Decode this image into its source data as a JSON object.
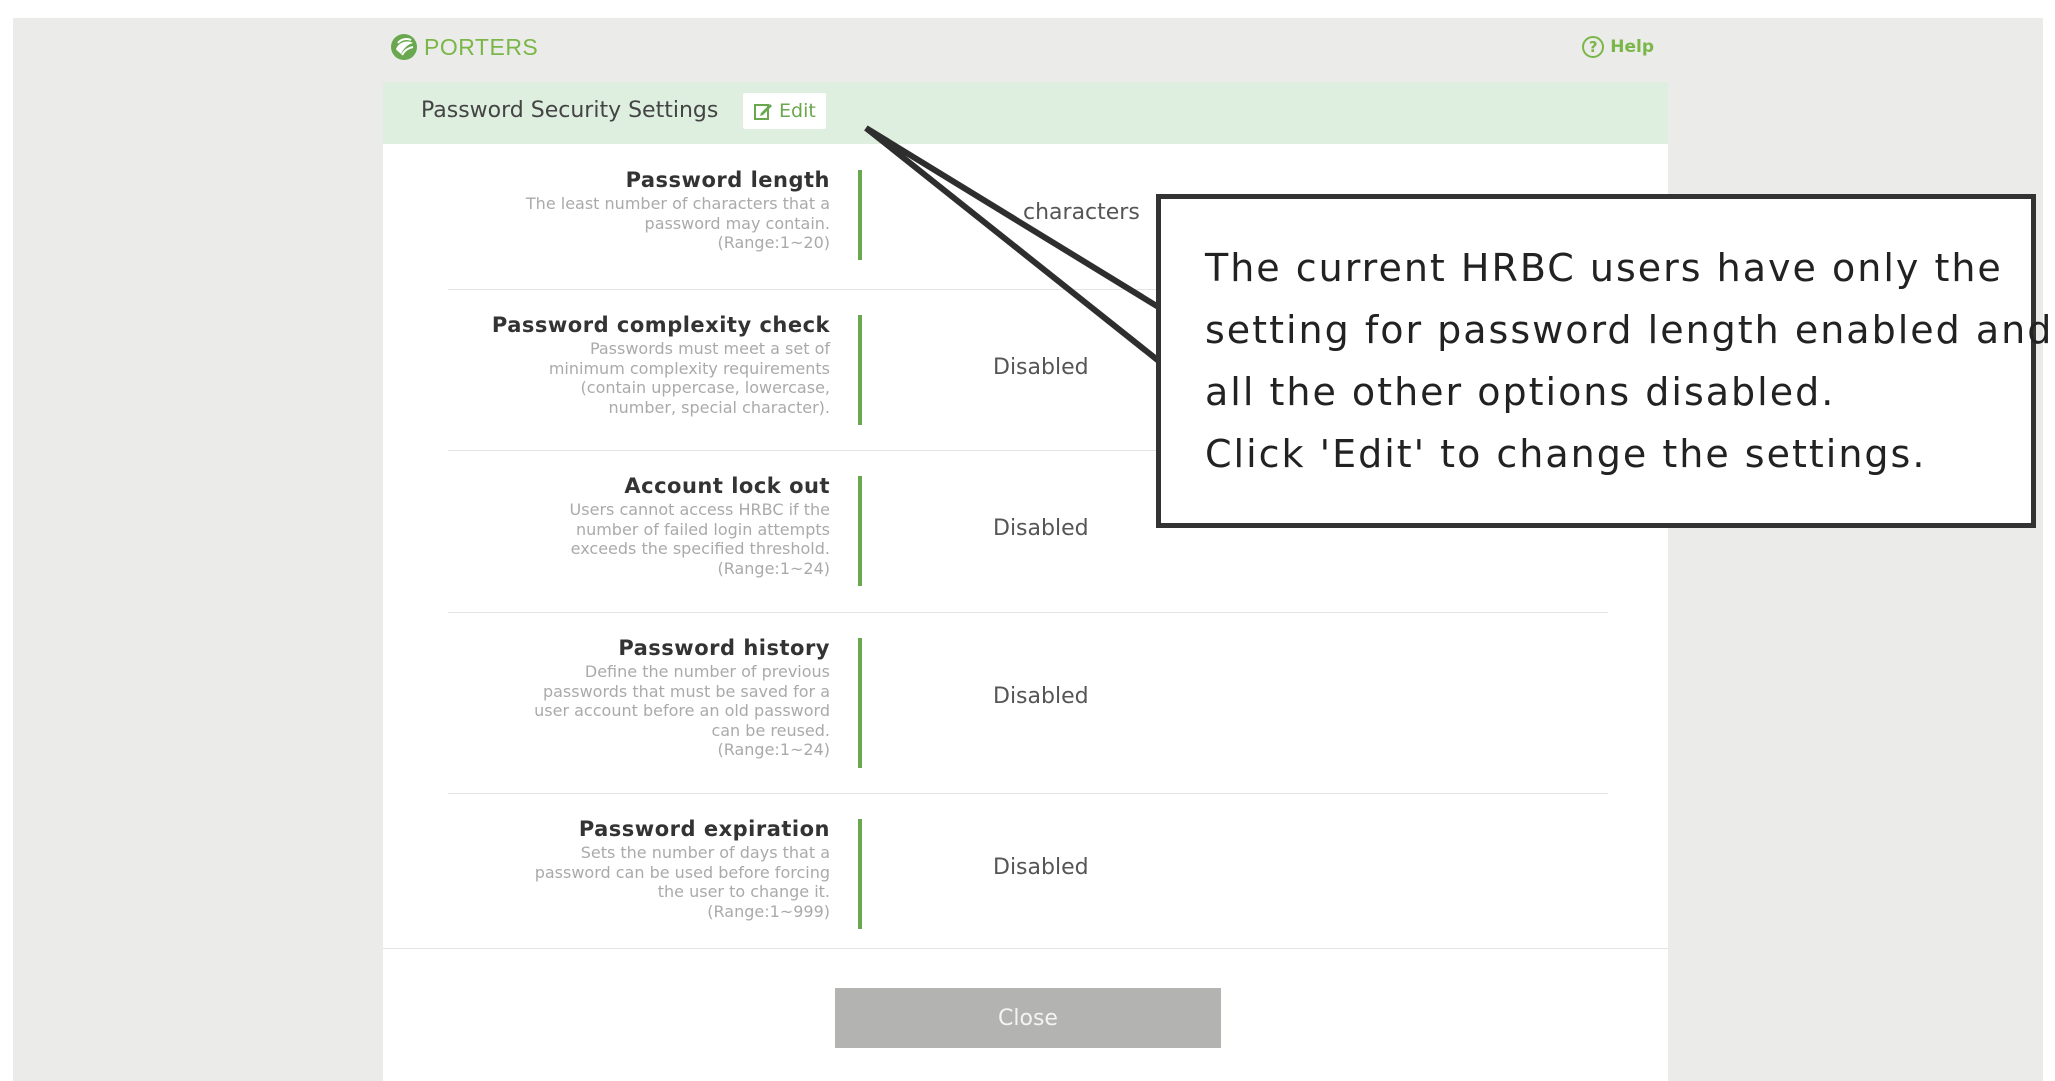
{
  "brand": {
    "name": "PORTERS"
  },
  "help": {
    "label": "Help"
  },
  "dialog": {
    "title": "Password Security Settings",
    "edit_label": "Edit",
    "close_label": "Close"
  },
  "settings": [
    {
      "label": "Password length",
      "desc": [
        "The least number of characters that a",
        "password may contain.",
        "(Range:1~20)"
      ],
      "value": "characters"
    },
    {
      "label": "Password complexity check",
      "desc": [
        "Passwords must meet a set of",
        "minimum complexity requirements",
        "(contain uppercase, lowercase,",
        "number, special character)."
      ],
      "value": "Disabled"
    },
    {
      "label": "Account lock out",
      "desc": [
        "Users cannot access HRBC if the",
        "number of failed login attempts",
        "exceeds the specified threshold.",
        "(Range:1~24)"
      ],
      "value": "Disabled"
    },
    {
      "label": "Password history",
      "desc": [
        "Define the number of previous",
        "passwords that must be saved for a",
        "user account before an old password",
        "can be reused.",
        "(Range:1~24)"
      ],
      "value": "Disabled"
    },
    {
      "label": "Password expiration",
      "desc": [
        "Sets the number of days that a",
        "password can be used before forcing",
        "the user to change it.",
        "(Range:1~999)"
      ],
      "value": "Disabled"
    }
  ],
  "callout": {
    "lines": [
      "The current HRBC users have only the",
      "setting for password length enabled and",
      "all the other options disabled.",
      "Click 'Edit' to change the settings."
    ]
  },
  "colors": {
    "accent": "#6aa84f",
    "header_bg": "#deefe0",
    "page_bg": "#ebebe9",
    "button_disabled": "#b3b3b1"
  }
}
